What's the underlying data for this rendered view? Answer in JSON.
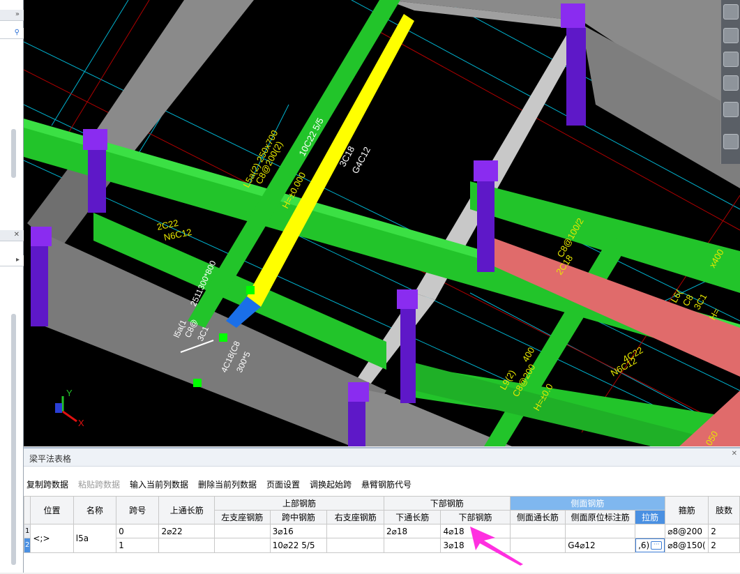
{
  "viewport": {
    "labels": [
      "10C22 5/5",
      "3C18",
      "G4C12",
      "L5a(2) 250x700",
      "C8@200(2)",
      "H=±0.000",
      "2C22",
      "N6C12",
      "C8@100/2",
      "2C18",
      "4C22",
      "N6C12",
      "L9(2)",
      "C8@200",
      "H=±0.0",
      "L6(",
      "C8",
      "3C1",
      "H=",
      "l5a(1",
      "C8@",
      "3C1",
      "2511300*800",
      "4C18(C8",
      "300*5",
      "x400",
      "400",
      "050"
    ],
    "axis_y": "Y",
    "axis_x": "X"
  },
  "panel": {
    "title": "梁平法表格",
    "toolbar": [
      "复制跨数据",
      "粘贴跨数据",
      "输入当前列数据",
      "删除当前列数据",
      "页面设置",
      "调换起始跨",
      "悬臂钢筋代号"
    ],
    "headers_group": {
      "position": "位置",
      "name": "名称",
      "span": "跨号",
      "top_through": "上通长筋",
      "top_steel": "上部钢筋",
      "bottom_steel": "下部钢筋",
      "side_steel": "侧面钢筋",
      "stirrup": "箍筋",
      "legs": "肢数"
    },
    "headers_sub": [
      "左支座钢筋",
      "跨中钢筋",
      "右支座钢筋",
      "下通长筋",
      "下部钢筋",
      "侧面通长筋",
      "侧面原位标注筋",
      "拉筋"
    ],
    "rows": [
      {
        "num": "1",
        "position": "<;>",
        "name": "l5a",
        "span": "0",
        "top_through": "2⌀22",
        "left_support": "",
        "mid": "3⌀16",
        "right_support": "",
        "bottom_through": "2⌀18",
        "bottom": "4⌀18",
        "side_through": "",
        "side_mark": "",
        "tie": "",
        "stirrup": "⌀8@200",
        "legs": "2"
      },
      {
        "num": "2",
        "position": "",
        "name": "",
        "span": "1",
        "top_through": "",
        "left_support": "",
        "mid": "10⌀22 5/5",
        "right_support": "",
        "bottom_through": "",
        "bottom": "3⌀18",
        "side_through": "",
        "side_mark": "G4⌀12",
        "tie": ",6)",
        "stirrup": "⌀8@150(",
        "legs": "2"
      }
    ]
  },
  "colors": {
    "beam_green": "#22c42a",
    "beam_gray": "#8a8a8a",
    "column_purple": "#6f1fe0",
    "highlight_yellow": "#ffff00",
    "beam_red": "#e06b6b",
    "selected_header": "#4a90e2",
    "arrow": "#ff2fe0"
  }
}
